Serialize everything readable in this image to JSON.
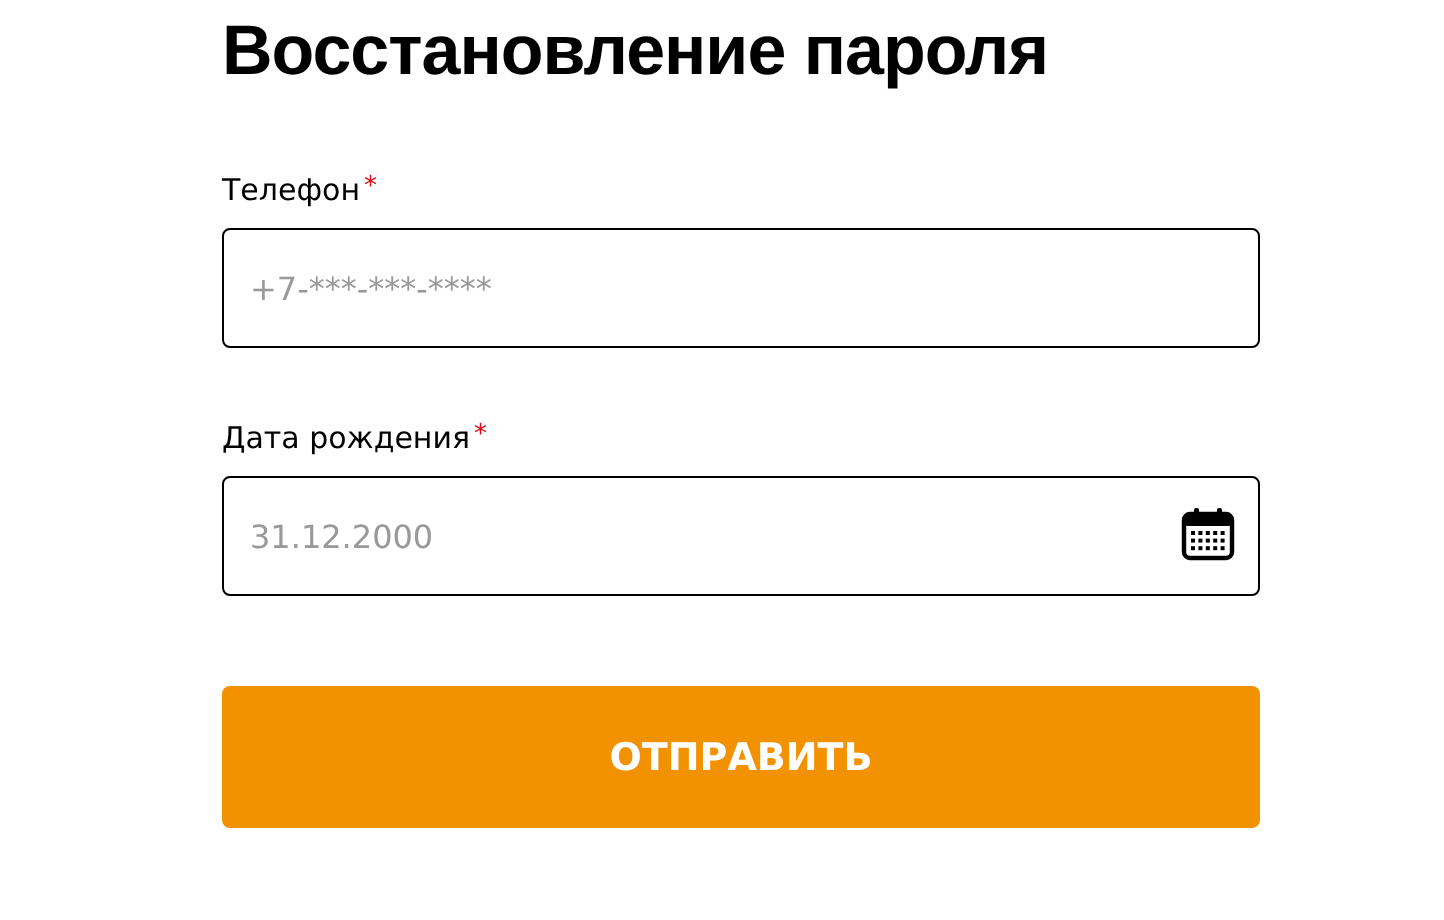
{
  "title": "Восстановление пароля",
  "fields": [
    {
      "kind": "phone",
      "label": "Телефон",
      "required": true,
      "required_mark": "*",
      "placeholder": "+7-***-***-****"
    },
    {
      "kind": "date",
      "label": "Дата рождения",
      "required": true,
      "required_mark": "*",
      "placeholder": "31.12.2000"
    }
  ],
  "submit": {
    "label": "ОТПРАВИТЬ"
  }
}
